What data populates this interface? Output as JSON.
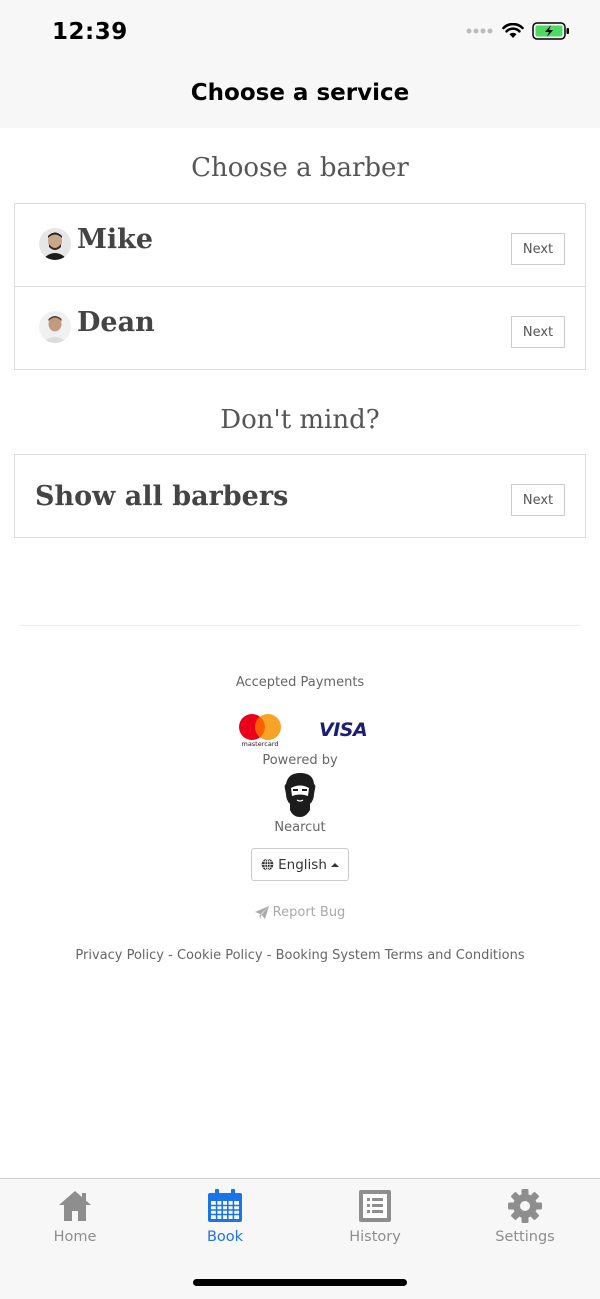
{
  "status_bar": {
    "time": "12:39"
  },
  "nav": {
    "title": "Choose a service"
  },
  "main": {
    "heading": "Choose a barber",
    "barbers": [
      {
        "name": "Mike",
        "button_label": "Next"
      },
      {
        "name": "Dean",
        "button_label": "Next"
      }
    ],
    "dont_mind_heading": "Don't mind?",
    "show_all": {
      "label": "Show all barbers",
      "button_label": "Next"
    }
  },
  "footer": {
    "accepted_payments_label": "Accepted Payments",
    "mastercard_label": "mastercard",
    "visa_label": "VISA",
    "powered_by_label": "Powered by",
    "brand_name": "Nearcut",
    "language_label": "English",
    "report_bug_label": "Report Bug",
    "legal": {
      "privacy": "Privacy Policy",
      "cookie": "Cookie Policy",
      "terms": "Booking System Terms and Conditions",
      "separator": " - "
    }
  },
  "tab_bar": {
    "active_color": "#1a73e8",
    "inactive_color": "#8e8e8e",
    "tabs": [
      {
        "label": "Home",
        "icon": "house-icon"
      },
      {
        "label": "Book",
        "icon": "calendar-icon"
      },
      {
        "label": "History",
        "icon": "document-icon"
      },
      {
        "label": "Settings",
        "icon": "gear-icon"
      }
    ]
  }
}
